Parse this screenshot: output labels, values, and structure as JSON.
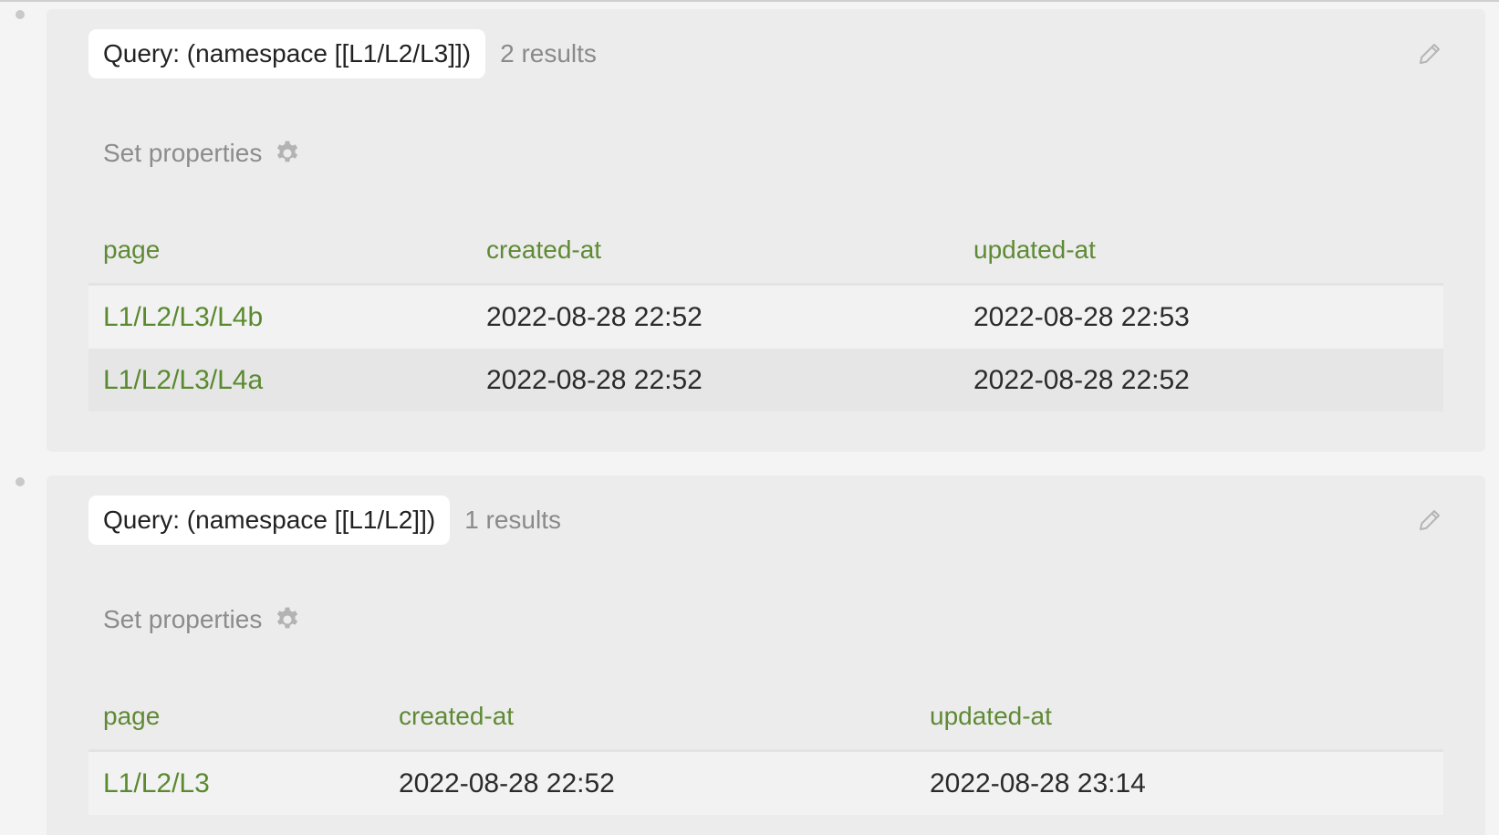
{
  "queries": [
    {
      "label": "Query: (namespace [[L1/L2/L3]])",
      "count": "2 results",
      "set_properties": "Set properties",
      "headers": [
        "page",
        "created-at",
        "updated-at"
      ],
      "rows": [
        {
          "page": "L1/L2/L3/L4b",
          "created": "2022-08-28 22:52",
          "updated": "2022-08-28 22:53"
        },
        {
          "page": "L1/L2/L3/L4a",
          "created": "2022-08-28 22:52",
          "updated": "2022-08-28 22:52"
        }
      ]
    },
    {
      "label": "Query: (namespace [[L1/L2]])",
      "count": "1 results",
      "set_properties": "Set properties",
      "headers": [
        "page",
        "created-at",
        "updated-at"
      ],
      "rows": [
        {
          "page": "L1/L2/L3",
          "created": "2022-08-28 22:52",
          "updated": "2022-08-28 23:14"
        }
      ]
    }
  ],
  "icons": {
    "edit": "pencil-icon",
    "settings": "gear-icon",
    "bullet": "bullet-dot-icon"
  },
  "colors": {
    "link": "#5a8a2f",
    "header": "#5f8a35",
    "block_bg": "#ececec",
    "page_bg": "#f4f4f4"
  }
}
